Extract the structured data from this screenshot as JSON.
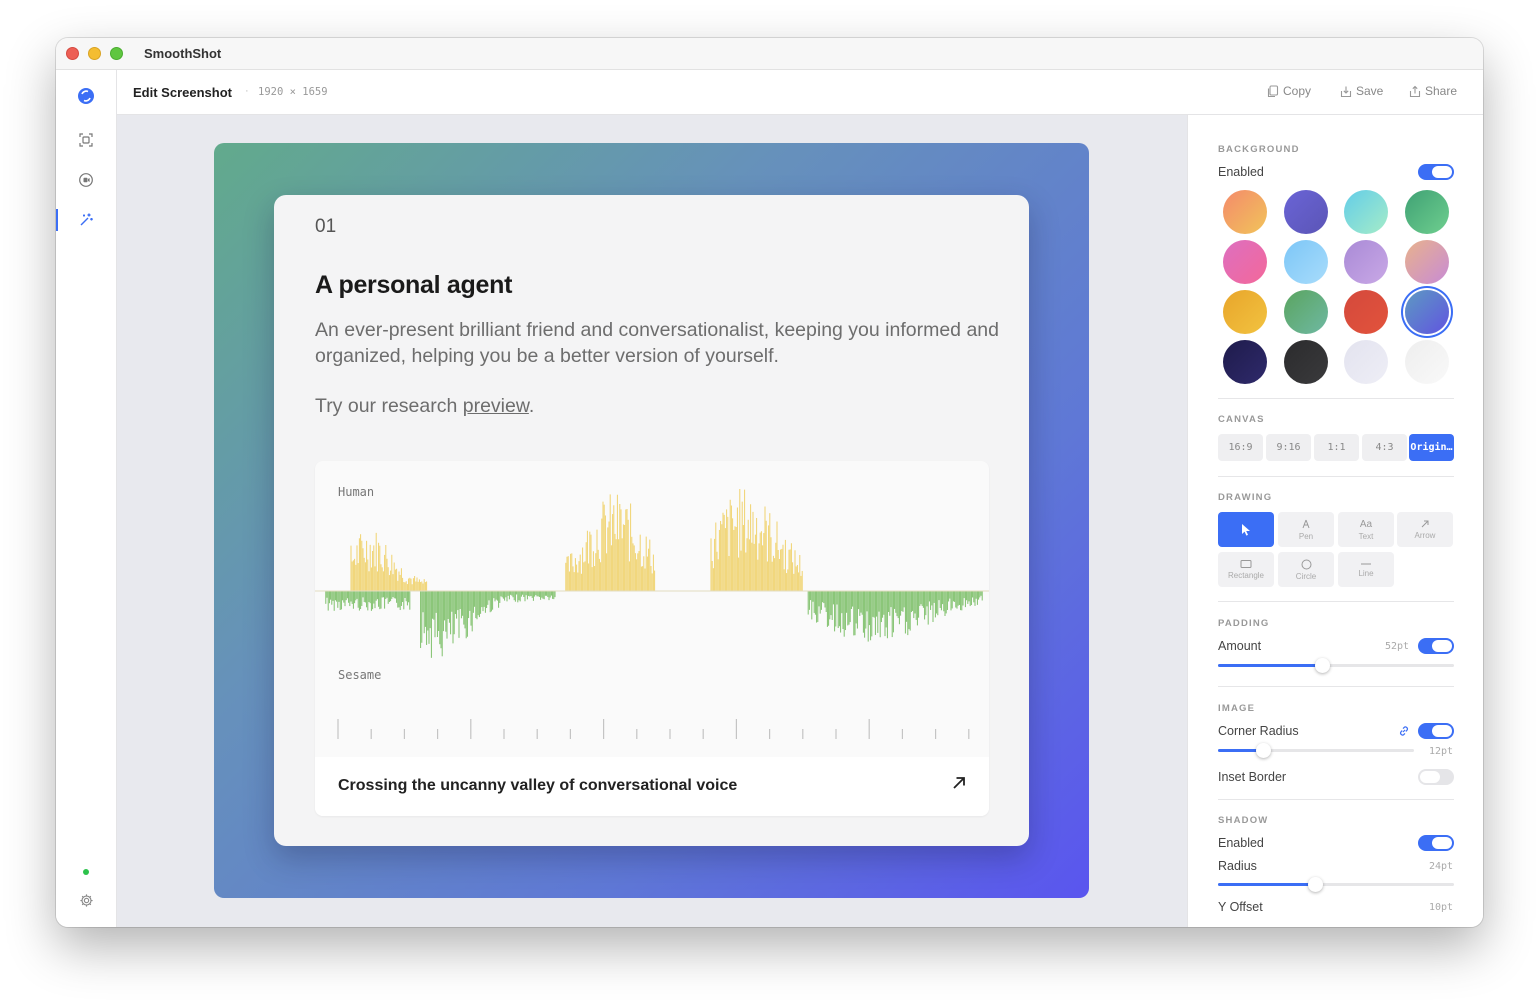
{
  "app": {
    "title": "SmoothShot"
  },
  "toolbar": {
    "title": "Edit Screenshot",
    "separator": "·",
    "dimensions": "1920 × 1659",
    "copy_label": "Copy",
    "save_label": "Save",
    "share_label": "Share"
  },
  "sidebar": {
    "items": [
      "app-logo-icon",
      "screenshot-icon",
      "record-icon",
      "magic-wand-icon"
    ],
    "active": "magic-wand-icon",
    "footer": [
      "status-dot",
      "gear-icon"
    ]
  },
  "card": {
    "number": "01",
    "title": "A personal agent",
    "body": "An ever-present brilliant friend and conversationalist, keeping you informed and organized, helping you be a better version of yourself.",
    "try_prefix": "Try our research ",
    "try_link": "preview",
    "try_suffix": ".",
    "wave_label_top": "Human",
    "wave_label_bottom": "Sesame",
    "caption": "Crossing the uncanny valley of conversational voice"
  },
  "panel": {
    "background": {
      "title": "BACKGROUND",
      "enabled_label": "Enabled",
      "enabled": true,
      "selected_index": 11,
      "swatches": [
        {
          "from": "#f48a6b",
          "to": "#f1c45a"
        },
        {
          "from": "#6a64d6",
          "to": "#5b55b6"
        },
        {
          "from": "#63cde8",
          "to": "#a5ecc8"
        },
        {
          "from": "#3fa174",
          "to": "#6fcf8f"
        },
        {
          "from": "#dd6fc0",
          "to": "#f3689a"
        },
        {
          "from": "#7cc6f7",
          "to": "#a8dcfb"
        },
        {
          "from": "#a98ad6",
          "to": "#c9a8e6"
        },
        {
          "from": "#e8b28c",
          "to": "#c88bd5"
        },
        {
          "from": "#e8a52b",
          "to": "#f2c340"
        },
        {
          "from": "#5aa45f",
          "to": "#6fb9a3"
        },
        {
          "from": "#d4493c",
          "to": "#e2533c"
        },
        {
          "from": "#5d9ac2",
          "to": "#6154e0"
        },
        {
          "from": "#1e1b4b",
          "to": "#2f2a6b"
        },
        {
          "from": "#2b2b2d",
          "to": "#3a3a3c"
        },
        {
          "from": "#e3e3ef",
          "to": "#eeeef6"
        },
        {
          "from": "#eeeeee",
          "to": "#f9f9f9"
        }
      ]
    },
    "canvas": {
      "title": "CANVAS",
      "options": [
        "16:9",
        "9:16",
        "1:1",
        "4:3",
        "Origin…"
      ],
      "active_index": 4
    },
    "drawing": {
      "title": "DRAWING",
      "tools": [
        {
          "label": "",
          "icon": "cursor-icon"
        },
        {
          "label": "Pen",
          "icon": "pen-icon"
        },
        {
          "label": "Text",
          "icon": "text-icon",
          "glyph": "Aa"
        },
        {
          "label": "Arrow",
          "icon": "arrow-icon"
        },
        {
          "label": "Rectangle",
          "icon": "rectangle-icon"
        },
        {
          "label": "Circle",
          "icon": "circle-icon"
        },
        {
          "label": "Line",
          "icon": "line-icon"
        }
      ],
      "active_index": 0
    },
    "padding": {
      "title": "PADDING",
      "amount_label": "Amount",
      "amount_value": "52pt",
      "enabled": true,
      "slider_fraction": 0.44
    },
    "image": {
      "title": "IMAGE",
      "corner_label": "Corner Radius",
      "corner_value": "12pt",
      "corner_enabled": true,
      "corner_slider_fraction": 0.23,
      "inset_label": "Inset Border",
      "inset_enabled": false
    },
    "shadow": {
      "title": "SHADOW",
      "enabled_label": "Enabled",
      "enabled": true,
      "radius_label": "Radius",
      "radius_value": "24pt",
      "radius_slider_fraction": 0.41,
      "yoffset_label": "Y Offset",
      "yoffset_value": "10pt"
    }
  },
  "colors": {
    "accent": "#3b6ef5",
    "human_wave": "#f0d36f",
    "sesame_wave": "#7fc06b"
  }
}
